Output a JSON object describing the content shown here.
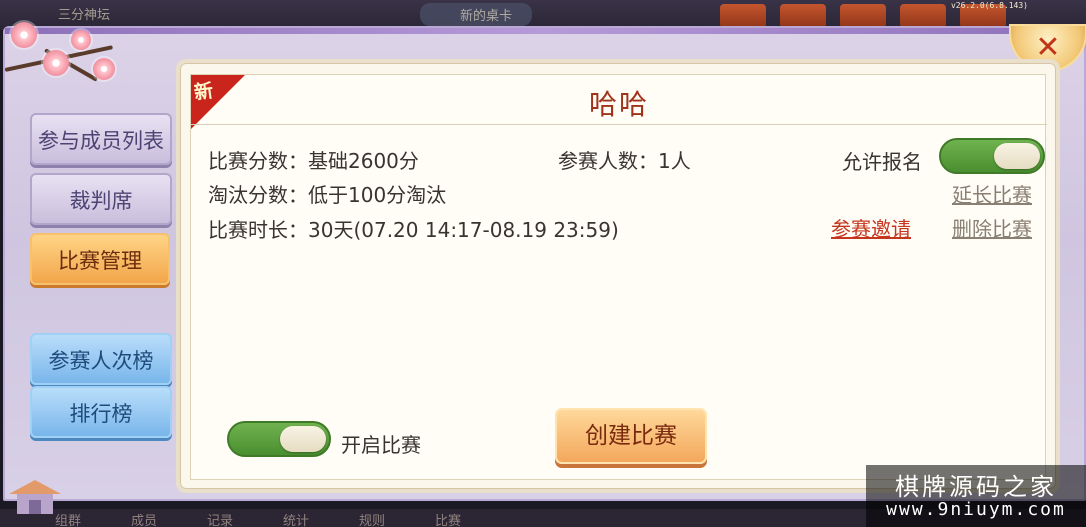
{
  "background": {
    "top_left_label": "三分神坛",
    "top_center_label": "新的桌卡",
    "version": "v26.2.0(6.8.143)",
    "bottom_nav": [
      "组群",
      "成员",
      "记录",
      "统计",
      "规则",
      "比赛"
    ]
  },
  "sidebar": {
    "items": [
      {
        "label": "参与成员列表"
      },
      {
        "label": "裁判席"
      },
      {
        "label": "比赛管理"
      },
      {
        "label": "参赛人次榜"
      },
      {
        "label": "排行榜"
      }
    ]
  },
  "match": {
    "badge": "新",
    "title": "哈哈",
    "score_label": "比赛分数：",
    "score_value": "基础2600分",
    "players_label": "参赛人数：",
    "players_value": "1人",
    "elim_label": "淘汰分数：",
    "elim_value": "低于100分淘汰",
    "duration_label": "比赛时长：",
    "duration_value": "30天(07.20 14:17-08.19 23:59)",
    "allow_signup_label": "允许报名",
    "allow_signup_on": true,
    "extend_label": "延长比赛",
    "invite_label": "参赛邀请",
    "delete_label": "删除比赛",
    "open_match_label": "开启比赛",
    "open_match_on": true,
    "create_label": "创建比赛"
  },
  "close_label": "✕",
  "watermark": {
    "line1": "棋牌源码之家",
    "line2": "www.9niuym.com"
  },
  "colors": {
    "accent_red": "#c6361e",
    "title_red": "#a0341b",
    "toggle_green": "#4a8f30",
    "active_orange": "#f2a64b",
    "panel_bg": "#fffdf6"
  }
}
